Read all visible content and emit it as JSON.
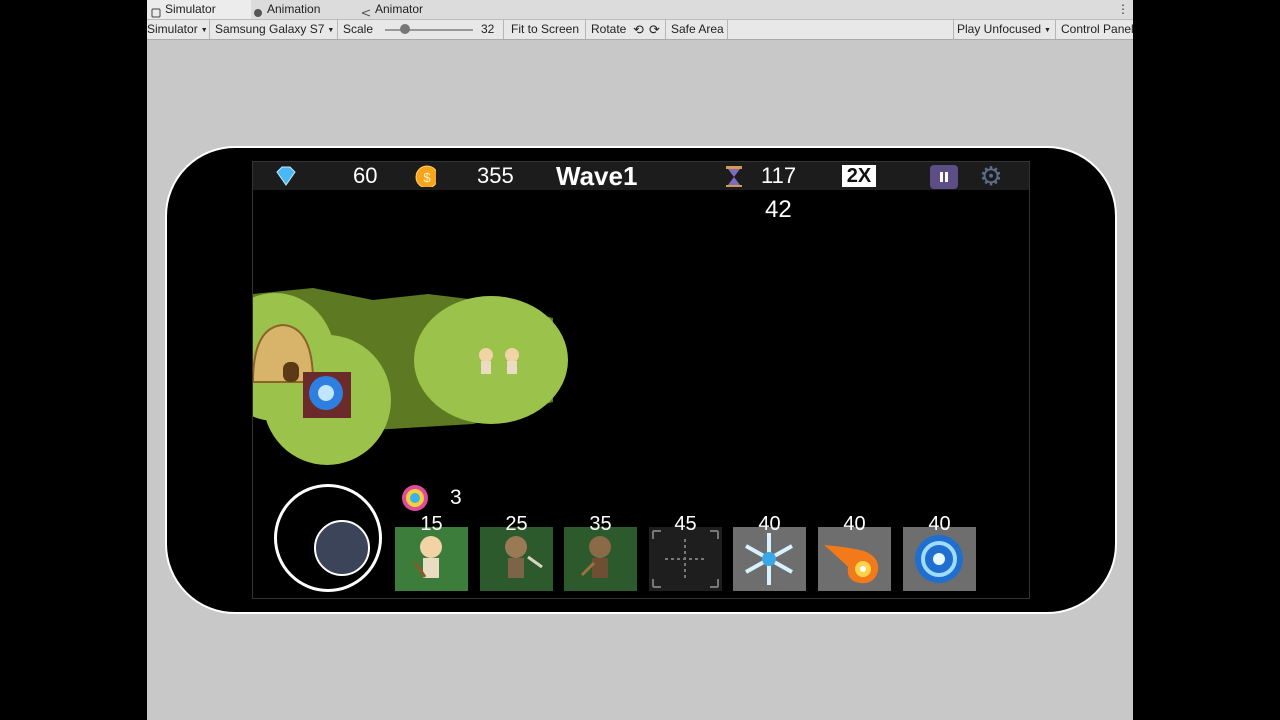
{
  "editor": {
    "tabs": [
      {
        "label": "Simulator",
        "icon": "simulator-icon"
      },
      {
        "label": "Animation",
        "icon": "animation-icon"
      },
      {
        "label": "Animator",
        "icon": "animator-icon"
      }
    ],
    "toolbar": {
      "mode": "Simulator",
      "device": "Samsung Galaxy S7",
      "scale_label": "Scale",
      "scale_value": "32",
      "fit_to_screen": "Fit to Screen",
      "rotate": "Rotate",
      "safe_area": "Safe Area",
      "play_mode": "Play Unfocused",
      "control_panel": "Control Panel"
    }
  },
  "game": {
    "hud": {
      "gems": "60",
      "coins": "355",
      "wave": "Wave1",
      "timer": "117",
      "speed": "2X",
      "countdown": "42"
    },
    "spiral_count": "3",
    "slots": [
      {
        "cost": "15",
        "kind": "archer"
      },
      {
        "cost": "25",
        "kind": "archer-dark"
      },
      {
        "cost": "35",
        "kind": "warrior"
      },
      {
        "cost": "45",
        "kind": "locked"
      },
      {
        "cost": "40",
        "kind": "freeze"
      },
      {
        "cost": "40",
        "kind": "fireball"
      },
      {
        "cost": "40",
        "kind": "vortex"
      }
    ]
  },
  "colors": {
    "pause_button": "#5d4d87",
    "grass": "#9bc24a",
    "dark_grass": "#5d7a22"
  }
}
